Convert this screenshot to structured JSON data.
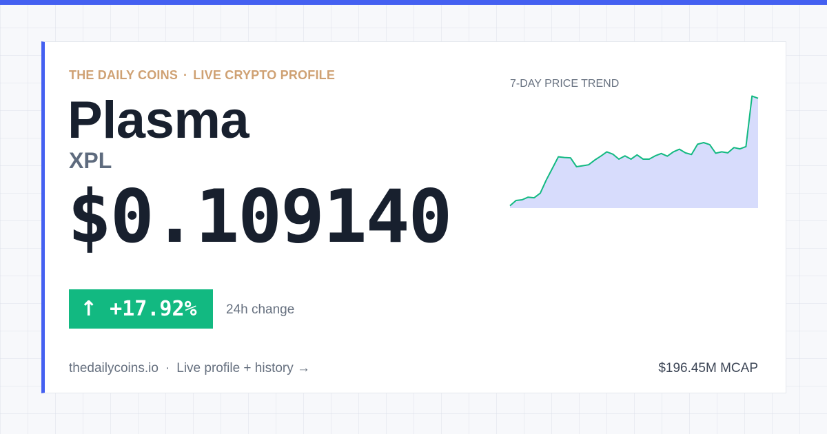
{
  "brand": {
    "name": "THE DAILY COINS",
    "separator": "·",
    "tagline": "LIVE CRYPTO PROFILE"
  },
  "coin": {
    "name": "Plasma",
    "symbol": "XPL",
    "price": "$0.109140"
  },
  "change": {
    "arrow": "↑",
    "value": "+17.92%",
    "label": "24h change",
    "direction": "up"
  },
  "footer": {
    "site": "thedailycoins.io",
    "separator": "·",
    "link": "Live profile + history →",
    "mcap": "$196.45M MCAP"
  },
  "colors": {
    "accent": "#4460f1",
    "brand": "#cfa173",
    "positive": "#12b981",
    "chart_line": "#12b981",
    "chart_fill": "#d7dcfc"
  },
  "chart_data": {
    "type": "area",
    "title": "7-DAY PRICE TREND",
    "xlabel": "",
    "ylabel": "",
    "grid": false,
    "values": [
      0.0752,
      0.0768,
      0.077,
      0.0778,
      0.0776,
      0.079,
      0.083,
      0.0865,
      0.09,
      0.0898,
      0.0897,
      0.087,
      0.0873,
      0.0876,
      0.089,
      0.0902,
      0.0915,
      0.0908,
      0.0893,
      0.0903,
      0.0893,
      0.0906,
      0.0893,
      0.0893,
      0.0903,
      0.091,
      0.0902,
      0.0915,
      0.0923,
      0.0912,
      0.0907,
      0.0938,
      0.0943,
      0.0937,
      0.0911,
      0.0915,
      0.0912,
      0.0928,
      0.0924,
      0.0931,
      0.1084,
      0.1077
    ],
    "ylim": [
      0.0745,
      0.1091
    ]
  }
}
